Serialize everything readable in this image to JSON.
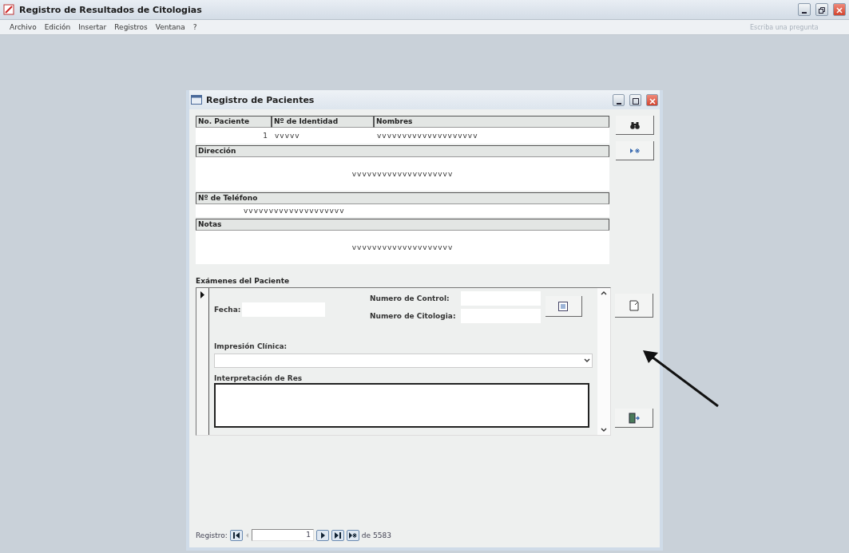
{
  "window": {
    "title": "Registro de Resultados de Citologias"
  },
  "menu": [
    "Archivo",
    "Edición",
    "Insertar",
    "Registros",
    "Ventana",
    "?"
  ],
  "help_box": {
    "placeholder": "Escriba una pregunta"
  },
  "form": {
    "title": "Registro de Pacientes",
    "top_fields": [
      {
        "label": "No. Paciente",
        "value": "1"
      },
      {
        "label": "Nº de Identidad",
        "value": "vvvvv"
      },
      {
        "label": "Nombres",
        "value": "vvvvvvvvvvvvvvvvvvvv"
      }
    ],
    "wide_fields": [
      {
        "label": "Dirección",
        "value": "vvvvvvvvvvvvvvvvvvvv",
        "kind": "tall"
      },
      {
        "label": "Nº de Teléfono",
        "value": "vvvvvvvvvvvvvvvvvvvv",
        "kind": "short"
      },
      {
        "label": "Notas",
        "value": "vvvvvvvvvvvvvvvvvvvv",
        "kind": "tall"
      }
    ],
    "subform": {
      "title": "Exámenes del Paciente",
      "date_label": "Fecha:",
      "control_label": "Numero de Control:",
      "cytology_label": "Numero de Citologia:",
      "impression_label": "Impresión Clínica:",
      "interpretation_label": "Interpretación de Res"
    },
    "navigator": {
      "label": "Registro:",
      "current": "1",
      "total": "de 5583"
    }
  }
}
